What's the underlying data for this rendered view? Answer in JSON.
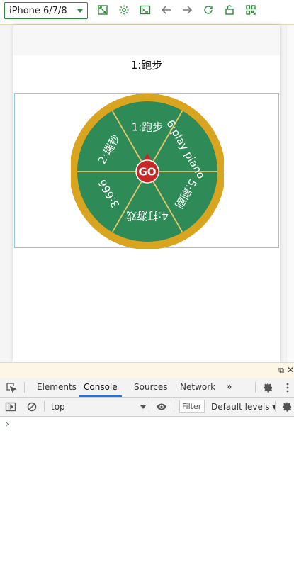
{
  "toolbar": {
    "device_selected": "iPhone 6/7/8",
    "icons": [
      "zoom-fit-icon",
      "settings-icon",
      "terminal-icon",
      "back-icon",
      "forward-icon",
      "refresh-icon",
      "unlock-icon",
      "qrcode-icon"
    ]
  },
  "page": {
    "result": "1:跑步"
  },
  "wheel": {
    "center_label": "GO",
    "segments": [
      "1:跑步",
      "6:play piano",
      "5:刷剧",
      "4:打游戏",
      "3:666",
      "2:瑞秒"
    ],
    "colors": {
      "rim": "#d9a520",
      "fill": "#2e8b57",
      "divider": "#e9c46a",
      "pointer": "#c62828",
      "text": "#ffffff"
    }
  },
  "devtools": {
    "tabs": [
      "Elements",
      "Console",
      "Sources",
      "Network"
    ],
    "active_tab": "Console",
    "context": "top",
    "filter_placeholder": "Filter",
    "levels": "Default levels ▾",
    "prompt": "›"
  }
}
